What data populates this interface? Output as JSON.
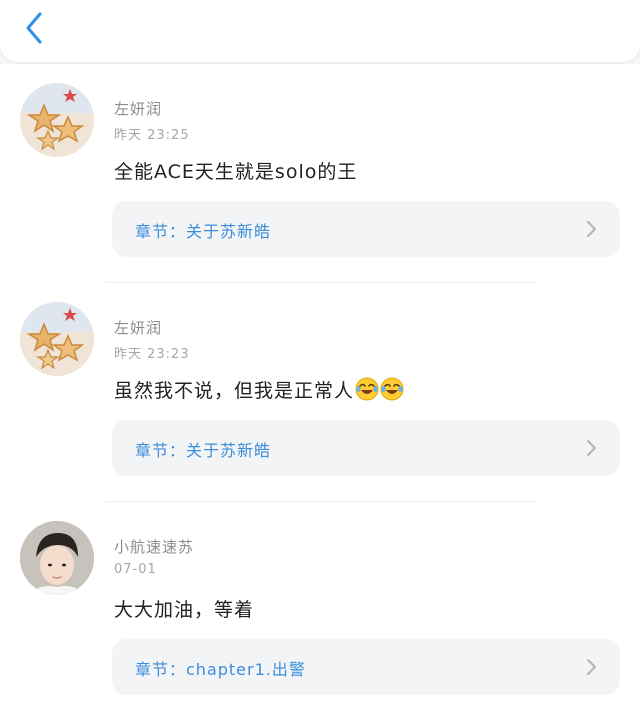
{
  "header": {
    "back_icon": "chevron-left-icon"
  },
  "colors": {
    "accent": "#3b8edb",
    "card_bg": "#f3f4f6",
    "muted": "#8c8c8c"
  },
  "comments": [
    {
      "username": "左妍润",
      "time": "昨天 23:25",
      "text": "全能ACE天生就是solo的王",
      "emojis": [],
      "chapter": "章节：关于苏新皓",
      "avatar": "stars-cookie-avatar"
    },
    {
      "username": "左妍润",
      "time": "昨天 23:23",
      "text": "虽然我不说，但我是正常人",
      "emojis": [
        "😂",
        "😂"
      ],
      "chapter": "章节：关于苏新皓",
      "avatar": "stars-cookie-avatar"
    },
    {
      "username": "小航速速苏",
      "time": "07-01",
      "text": "大大加油，等着",
      "emojis": [],
      "chapter": "章节：chapter1.出警",
      "avatar": "person-avatar"
    }
  ]
}
